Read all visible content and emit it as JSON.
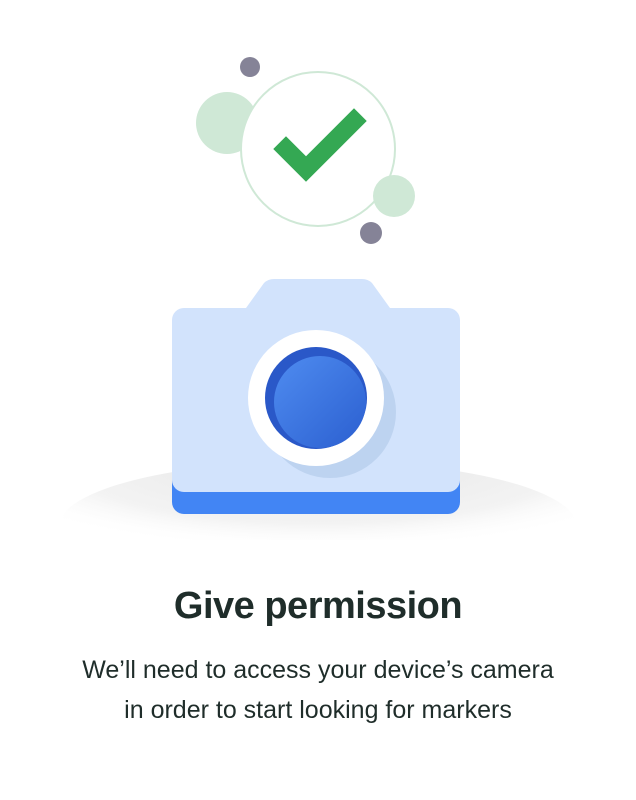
{
  "permission_screen": {
    "title": "Give permission",
    "description_line1": "We’ll need to access your device’s camera",
    "description_line2": "in order to start looking for markers"
  },
  "illustration": {
    "icons": [
      "checkmark-icon",
      "camera-icon"
    ],
    "colors": {
      "check_green": "#34a853",
      "check_bubble": "#cfe8d6",
      "dot_gray": "#858397",
      "camera_body": "#d2e3fc",
      "camera_base": "#4285f4",
      "lens": "#3f76e0",
      "ground": "#ececec"
    }
  }
}
